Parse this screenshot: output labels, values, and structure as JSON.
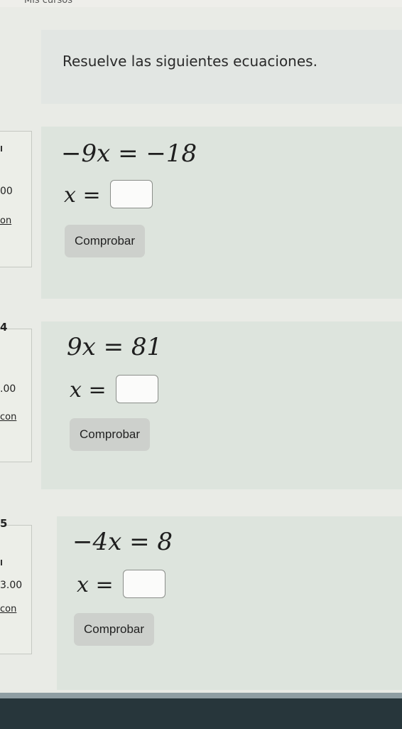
{
  "header": {
    "course_label": "Mis cursos"
  },
  "instructions": "Resuelve las siguientes ecuaciones.",
  "questions": [
    {
      "number": "",
      "points": "00",
      "link": "on",
      "equation": "−9x = −18",
      "answer_lhs": "x",
      "answer_eq": "=",
      "answer_value": "",
      "check_label": "Comprobar"
    },
    {
      "number": "4",
      "points": ".00",
      "link": "con",
      "equation": "9x = 81",
      "answer_lhs": "x",
      "answer_eq": "=",
      "answer_value": "",
      "check_label": "Comprobar"
    },
    {
      "number": "5",
      "points": "3.00",
      "link": "con",
      "equation": "−4x = 8",
      "answer_lhs": "x",
      "answer_eq": "=",
      "answer_value": "",
      "check_label": "Comprobar"
    }
  ]
}
